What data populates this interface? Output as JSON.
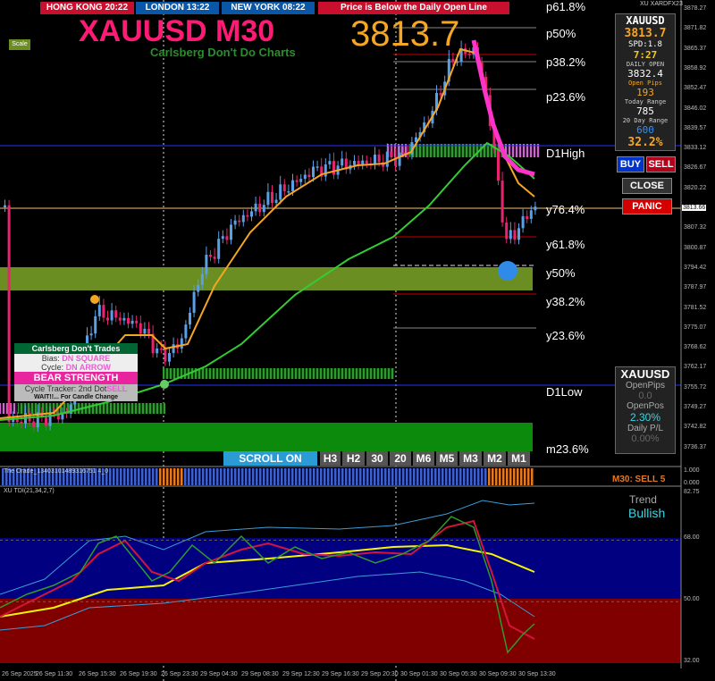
{
  "sessions": [
    {
      "label": "HONG KONG 20:22",
      "color": "#c8102e"
    },
    {
      "label": "LONDON  13:22",
      "color": "#0a57a8"
    },
    {
      "label": "NEW YORK  08:22",
      "color": "#0a57a8"
    }
  ],
  "banner": "Price is Below the Daily Open Line",
  "title": "XAUUSD M30",
  "subtitle": "Carlsberg Don't Do Charts",
  "price_big": "3813.7",
  "scale_label": "Scale",
  "corner_label": "XU XARDFX23",
  "info_panel": {
    "symbol": "XAUUSD",
    "price": "3813.7",
    "spd": "SPD:1.8",
    "countdown": "7:27",
    "daily_open_label": "DAILY OPEN",
    "daily_open": "3832.4",
    "open_pips_label": "Open Pips",
    "open_pips": "193",
    "today_range_label": "Today Range",
    "today_range": "785",
    "day20_label": "20 Day Range",
    "day20": "600",
    "pct": "32.2%"
  },
  "buttons": {
    "buy": "BUY",
    "sell": "SELL",
    "close": "CLOSE",
    "panic": "PANIC"
  },
  "levels": {
    "p61": "p61.8%",
    "p50": "p50%",
    "p38": "p38.2%",
    "p23": "p23.6%",
    "d1high": "D1High",
    "y76": "y76.4%",
    "y61": "y61.8%",
    "y50": "y50%",
    "y38": "y38.2%",
    "y23": "y23.6%",
    "d1low": "D1Low",
    "m23": "m23.6%"
  },
  "trades_panel": {
    "title": "Carlsberg Don't Trades",
    "bias_label": "Bias:",
    "bias_value": "DN SQUARE",
    "cycle_label": "Cycle:",
    "cycle_value": "DN ARROW",
    "strength": "BEAR STRENGTH",
    "tracker_label": "Cycle Tracker: 2nd Dot",
    "tracker_value": "SELL",
    "wait": "WAIT!!... For Candle Change"
  },
  "pips_panel": {
    "symbol": "XAUUSD",
    "open_pips_label": "OpenPips",
    "open_pips": "0.0",
    "open_pos_label": "OpenPos",
    "open_pos": "2.30%",
    "daily_pl_label": "Daily P/L",
    "daily_pl": "0.00%"
  },
  "scroll_label": "SCROLL ON",
  "timeframes": [
    "H3",
    "H2",
    "30",
    "20",
    "M6",
    "M5",
    "M3",
    "M2",
    "M1"
  ],
  "orade_label": "The Orade_13403101489316751 4_0",
  "orade_signal": "M30: SELL 5",
  "orade_ticks": [
    "1.000",
    "0.000"
  ],
  "tdi_label": "XU TDI(21,34,2,7)",
  "trend_label": "Trend",
  "trend_value": "Bullish",
  "colors": {
    "up": "#5aa0e6",
    "down": "#e8246e",
    "ma_fast": "#f5a623",
    "ma_slow": "#33cc33",
    "magenta": "#ff33cc"
  },
  "price_ticks": [
    "3878.27",
    "3871.82",
    "3865.37",
    "3858.92",
    "3852.47",
    "3846.02",
    "3839.57",
    "3833.12",
    "3826.67",
    "3820.22",
    "3813.66",
    "3807.32",
    "3800.87",
    "3794.42",
    "3787.97",
    "3781.52",
    "3775.07",
    "3768.62",
    "3762.17",
    "3755.72",
    "3749.27",
    "3742.82",
    "3736.37"
  ],
  "price_current": "3813.66",
  "tdi_ticks": [
    "82.75",
    "68.00",
    "50.00",
    "32.00"
  ],
  "time_ticks": [
    "26 Sep 2025",
    "26 Sep 11:30",
    "26 Sep 15:30",
    "26 Sep 19:30",
    "26 Sep 23:30",
    "29 Sep 04:30",
    "29 Sep 08:30",
    "29 Sep 12:30",
    "29 Sep 16:30",
    "29 Sep 20:30",
    "30 Sep 01:30",
    "30 Sep 05:30",
    "30 Sep 09:30",
    "30 Sep 13:30"
  ]
}
